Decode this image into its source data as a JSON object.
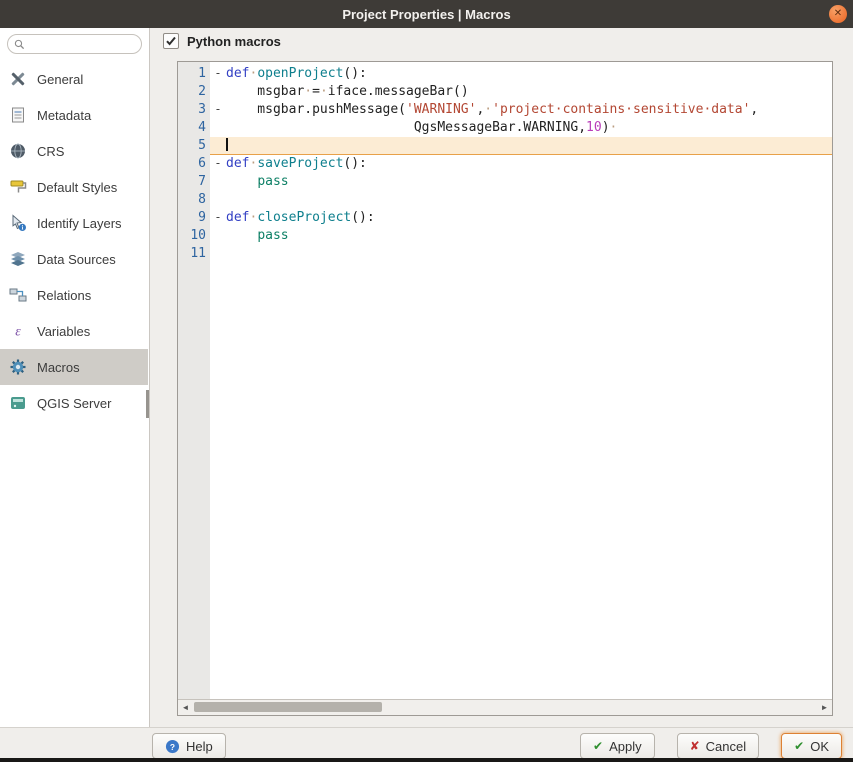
{
  "window": {
    "title": "Project Properties | Macros",
    "close_glyph": "✕"
  },
  "colors": {
    "titlebar_bg": "#3e3b37",
    "close_button": "#ee7434",
    "selected_item_bg": "#cfccc7",
    "current_line_bg": "#fcecd4",
    "current_line_edge": "#e8a149",
    "focus_ring": "#dd8134",
    "keyword": "#3340c4",
    "function_name": "#0e7f8d",
    "string": "#b34733",
    "number": "#b93eb9",
    "line_number": "#2e64a0"
  },
  "sidebar": {
    "search": {
      "placeholder": "",
      "value": ""
    },
    "items": [
      {
        "label": "General",
        "icon": "general",
        "selected": false
      },
      {
        "label": "Metadata",
        "icon": "metadata",
        "selected": false
      },
      {
        "label": "CRS",
        "icon": "crs",
        "selected": false
      },
      {
        "label": "Default Styles",
        "icon": "default-styles",
        "selected": false
      },
      {
        "label": "Identify Layers",
        "icon": "identify-layers",
        "selected": false
      },
      {
        "label": "Data Sources",
        "icon": "data-sources",
        "selected": false
      },
      {
        "label": "Relations",
        "icon": "relations",
        "selected": false
      },
      {
        "label": "Variables",
        "icon": "variables",
        "selected": false
      },
      {
        "label": "Macros",
        "icon": "macros",
        "selected": true
      },
      {
        "label": "QGIS Server",
        "icon": "qgis-server",
        "selected": false
      }
    ]
  },
  "main": {
    "python_macros": {
      "label": "Python macros",
      "checked": true
    }
  },
  "editor": {
    "lines": [
      {
        "num": "1",
        "fold": "-",
        "current": false,
        "cursor": false,
        "tokens": [
          [
            "kw",
            "def"
          ],
          [
            "ws",
            "·"
          ],
          [
            "fn",
            "openProject"
          ],
          [
            "pl",
            "():"
          ]
        ]
      },
      {
        "num": "2",
        "fold": "",
        "current": false,
        "cursor": false,
        "tokens": [
          [
            "pl",
            "    msgbar"
          ],
          [
            "ws",
            "·"
          ],
          [
            "pl",
            "="
          ],
          [
            "ws",
            "·"
          ],
          [
            "pl",
            "iface.messageBar()"
          ]
        ]
      },
      {
        "num": "3",
        "fold": "-",
        "current": false,
        "cursor": false,
        "tokens": [
          [
            "pl",
            "    msgbar.pushMessage("
          ],
          [
            "st",
            "'WARNING'"
          ],
          [
            "pl",
            ","
          ],
          [
            "ws",
            "·"
          ],
          [
            "st",
            "'project·contains·sensitive·data'"
          ],
          [
            "pl",
            ","
          ]
        ]
      },
      {
        "num": "4",
        "fold": "",
        "current": false,
        "cursor": false,
        "tokens": [
          [
            "pl",
            "                        QgsMessageBar.WARNING,"
          ],
          [
            "nu",
            "10"
          ],
          [
            "pl",
            ")"
          ],
          [
            "ws",
            "·"
          ]
        ]
      },
      {
        "num": "5",
        "fold": "",
        "current": true,
        "cursor": true,
        "tokens": []
      },
      {
        "num": "6",
        "fold": "-",
        "current": false,
        "cursor": false,
        "tokens": [
          [
            "kw",
            "def"
          ],
          [
            "ws",
            "·"
          ],
          [
            "fn",
            "saveProject"
          ],
          [
            "pl",
            "():"
          ]
        ]
      },
      {
        "num": "7",
        "fold": "",
        "current": false,
        "cursor": false,
        "tokens": [
          [
            "pl",
            "    "
          ],
          [
            "kw2",
            "pass"
          ]
        ]
      },
      {
        "num": "8",
        "fold": "",
        "current": false,
        "cursor": false,
        "tokens": []
      },
      {
        "num": "9",
        "fold": "-",
        "current": false,
        "cursor": false,
        "tokens": [
          [
            "kw",
            "def"
          ],
          [
            "ws",
            "·"
          ],
          [
            "fn",
            "closeProject"
          ],
          [
            "pl",
            "():"
          ]
        ]
      },
      {
        "num": "10",
        "fold": "",
        "current": false,
        "cursor": false,
        "tokens": [
          [
            "pl",
            "    "
          ],
          [
            "kw2",
            "pass"
          ]
        ]
      },
      {
        "num": "11",
        "fold": "",
        "current": false,
        "cursor": false,
        "tokens": []
      }
    ]
  },
  "footer": {
    "help": {
      "label": "Help",
      "icon": "help-circle",
      "icon_glyph": "?"
    },
    "apply": {
      "label": "Apply",
      "icon": "check",
      "icon_glyph": "✔"
    },
    "cancel": {
      "label": "Cancel",
      "icon": "cross",
      "icon_glyph": "✘"
    },
    "ok": {
      "label": "OK",
      "icon": "check",
      "icon_glyph": "✔"
    }
  }
}
